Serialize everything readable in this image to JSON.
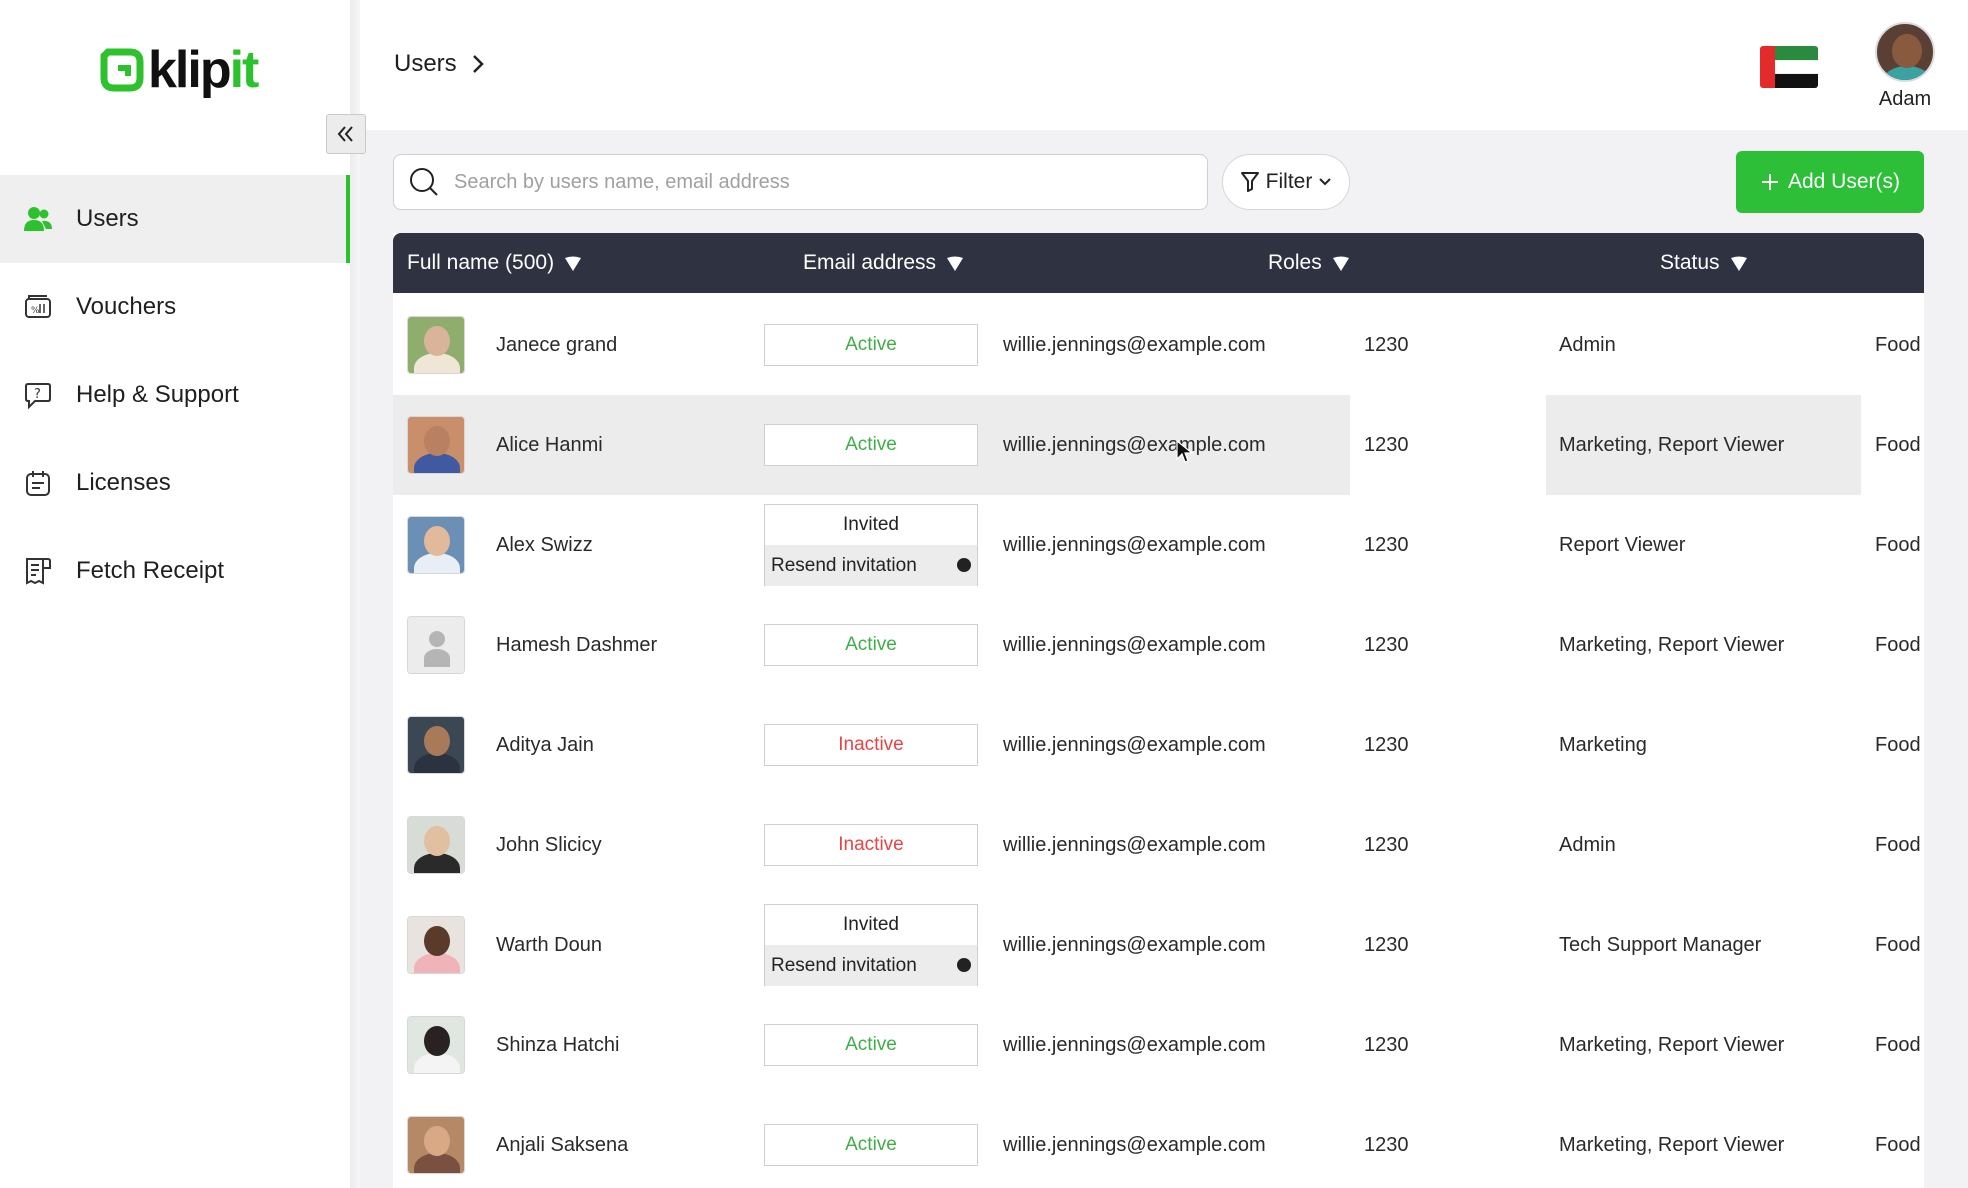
{
  "brand": {
    "logo_main": "klip",
    "logo_accent": "it",
    "accent_color": "#2dc22d"
  },
  "sidebar": {
    "items": [
      {
        "label": "Users",
        "icon": "users-icon",
        "active": true
      },
      {
        "label": "Vouchers",
        "icon": "voucher-icon",
        "active": false
      },
      {
        "label": "Help & Support",
        "icon": "help-icon",
        "active": false
      },
      {
        "label": "Licenses",
        "icon": "license-icon",
        "active": false
      },
      {
        "label": "Fetch Receipt",
        "icon": "receipt-icon",
        "active": false
      }
    ]
  },
  "header": {
    "breadcrumb": "Users",
    "user_name": "Adam"
  },
  "toolbar": {
    "search_placeholder": "Search by users name, email address",
    "filter_label": "Filter",
    "add_label": "Add User(s)"
  },
  "table": {
    "headers": {
      "name": "Full name (500)",
      "email": "Email address",
      "roles": "Roles",
      "status": "Status"
    },
    "rows": [
      {
        "name": "Janece grand",
        "status": "Active",
        "email": "willie.jennings@example.com",
        "code": "1230",
        "roles": "Admin",
        "extra": "Food"
      },
      {
        "name": "Alice Hanmi",
        "status": "Active",
        "email": "willie.jennings@example.com",
        "code": "1230",
        "roles": "Marketing,  Report Viewer",
        "extra": "Food"
      },
      {
        "name": "Alex Swizz",
        "status": "Invited",
        "resend": "Resend invitation",
        "email": "willie.jennings@example.com",
        "code": "1230",
        "roles": "Report Viewer",
        "extra": "Food"
      },
      {
        "name": "Hamesh Dashmer",
        "status": "Active",
        "email": "willie.jennings@example.com",
        "code": "1230",
        "roles": "Marketing,  Report Viewer",
        "extra": "Food"
      },
      {
        "name": "Aditya Jain",
        "status": "Inactive",
        "email": "willie.jennings@example.com",
        "code": "1230",
        "roles": "Marketing",
        "extra": "Food"
      },
      {
        "name": "John Slicicy",
        "status": "Inactive",
        "email": "willie.jennings@example.com",
        "code": "1230",
        "roles": "Admin",
        "extra": "Food"
      },
      {
        "name": "Warth Doun",
        "status": "Invited",
        "resend": "Resend invitation",
        "email": "willie.jennings@example.com",
        "code": "1230",
        "roles": "Tech Support Manager",
        "extra": "Food"
      },
      {
        "name": "Shinza Hatchi",
        "status": "Active",
        "email": "willie.jennings@example.com",
        "code": "1230",
        "roles": "Marketing,  Report Viewer",
        "extra": "Food"
      },
      {
        "name": "Anjali Saksena",
        "status": "Active",
        "email": "willie.jennings@example.com",
        "code": "1230",
        "roles": "Marketing,  Report Viewer",
        "extra": "Food"
      }
    ]
  }
}
